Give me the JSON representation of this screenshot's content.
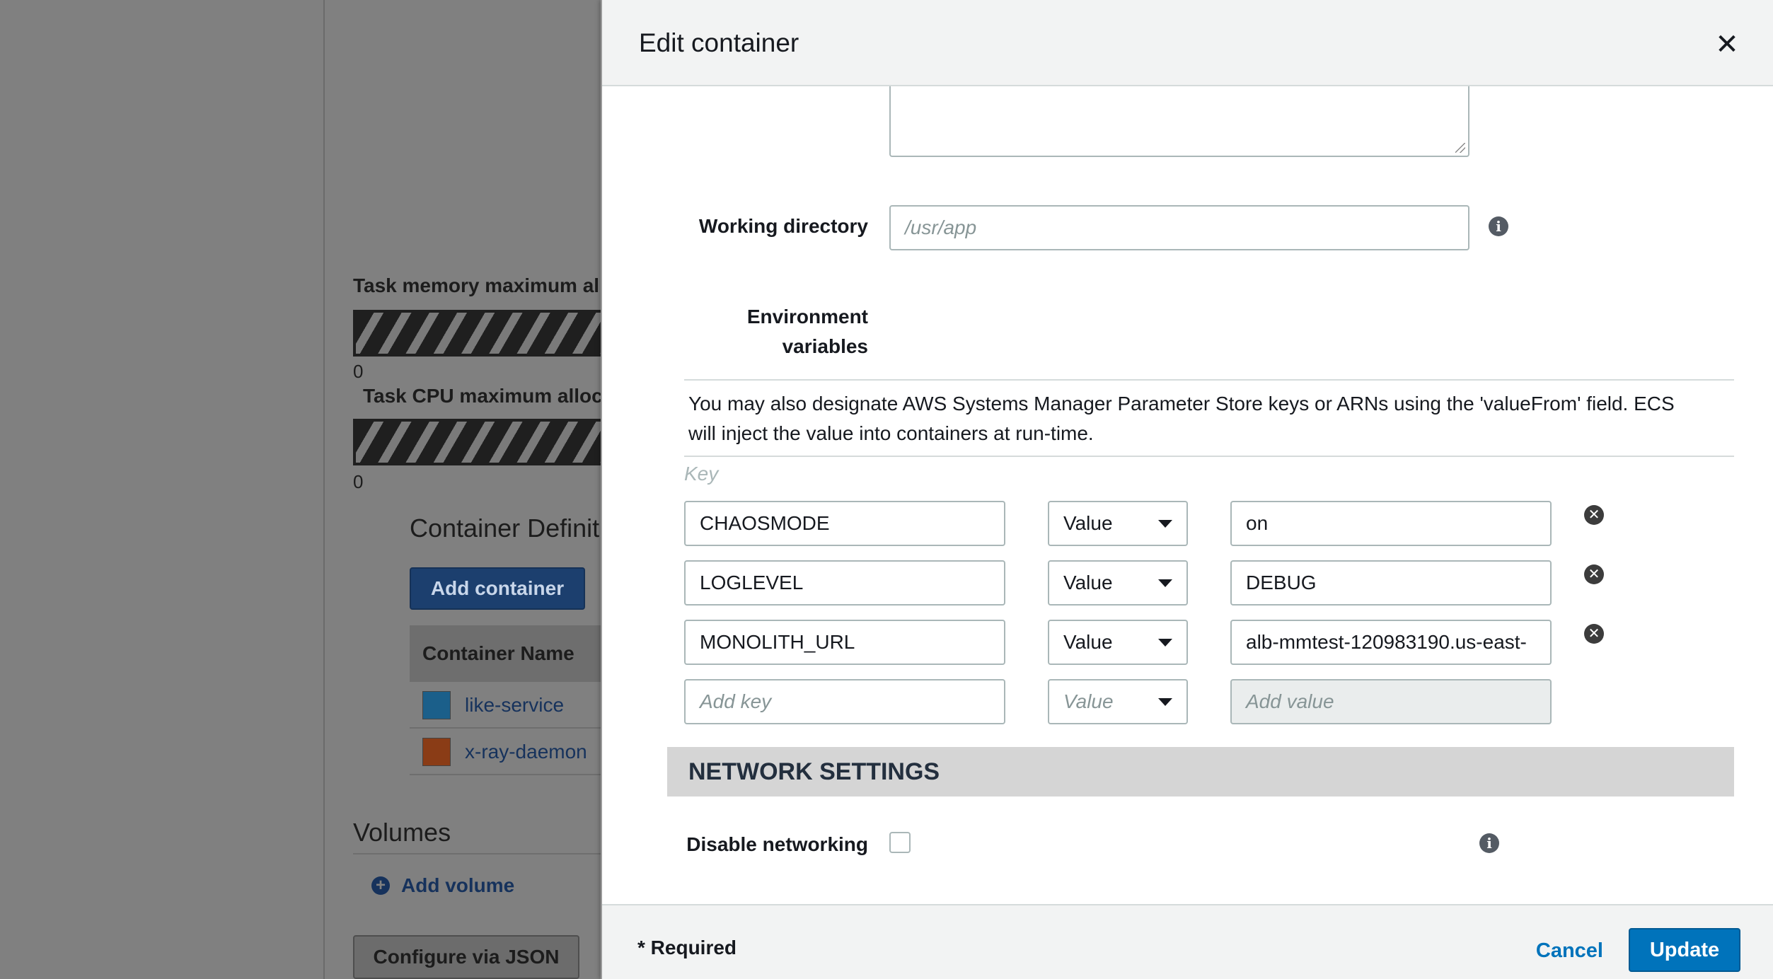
{
  "background": {
    "task_memory_label": "Task memory maximum al",
    "task_memory_value": "0",
    "task_cpu_label": "Task CPU maximum alloc",
    "task_cpu_value": "0",
    "container_definitions_heading": "Container Definit",
    "add_container_label": "Add container",
    "table_header": "Container Name",
    "containers": [
      {
        "name": "like-service",
        "color": "#1b5f8a"
      },
      {
        "name": "x-ray-daemon",
        "color": "#8a3c16"
      }
    ],
    "volumes_heading": "Volumes",
    "add_volume_label": "Add volume",
    "configure_json_label": "Configure via JSON"
  },
  "modal": {
    "title": "Edit container",
    "close_symbol": "✕",
    "working_directory": {
      "label": "Working directory",
      "placeholder": "/usr/app"
    },
    "environment": {
      "label_line1": "Environment",
      "label_line2": "variables",
      "help_text": "You may also designate AWS Systems Manager Parameter Store keys or ARNs using the 'valueFrom' field. ECS will inject the value into containers at run-time.",
      "key_header": "Key",
      "rows": [
        {
          "key": "CHAOSMODE",
          "type": "Value",
          "value": "on"
        },
        {
          "key": "LOGLEVEL",
          "type": "Value",
          "value": "DEBUG"
        },
        {
          "key": "MONOLITH_URL",
          "type": "Value",
          "value": "alb-mmtest-120983190.us-east-"
        }
      ],
      "new_row": {
        "key_placeholder": "Add key",
        "type_placeholder": "Value",
        "value_placeholder": "Add value"
      }
    },
    "network_settings": {
      "heading": "NETWORK SETTINGS",
      "disable_networking_label": "Disable networking"
    },
    "footer": {
      "required_note": "* Required",
      "cancel_label": "Cancel",
      "update_label": "Update"
    }
  },
  "colors": {
    "primary": "#0073bb",
    "overlay": "#808080"
  }
}
